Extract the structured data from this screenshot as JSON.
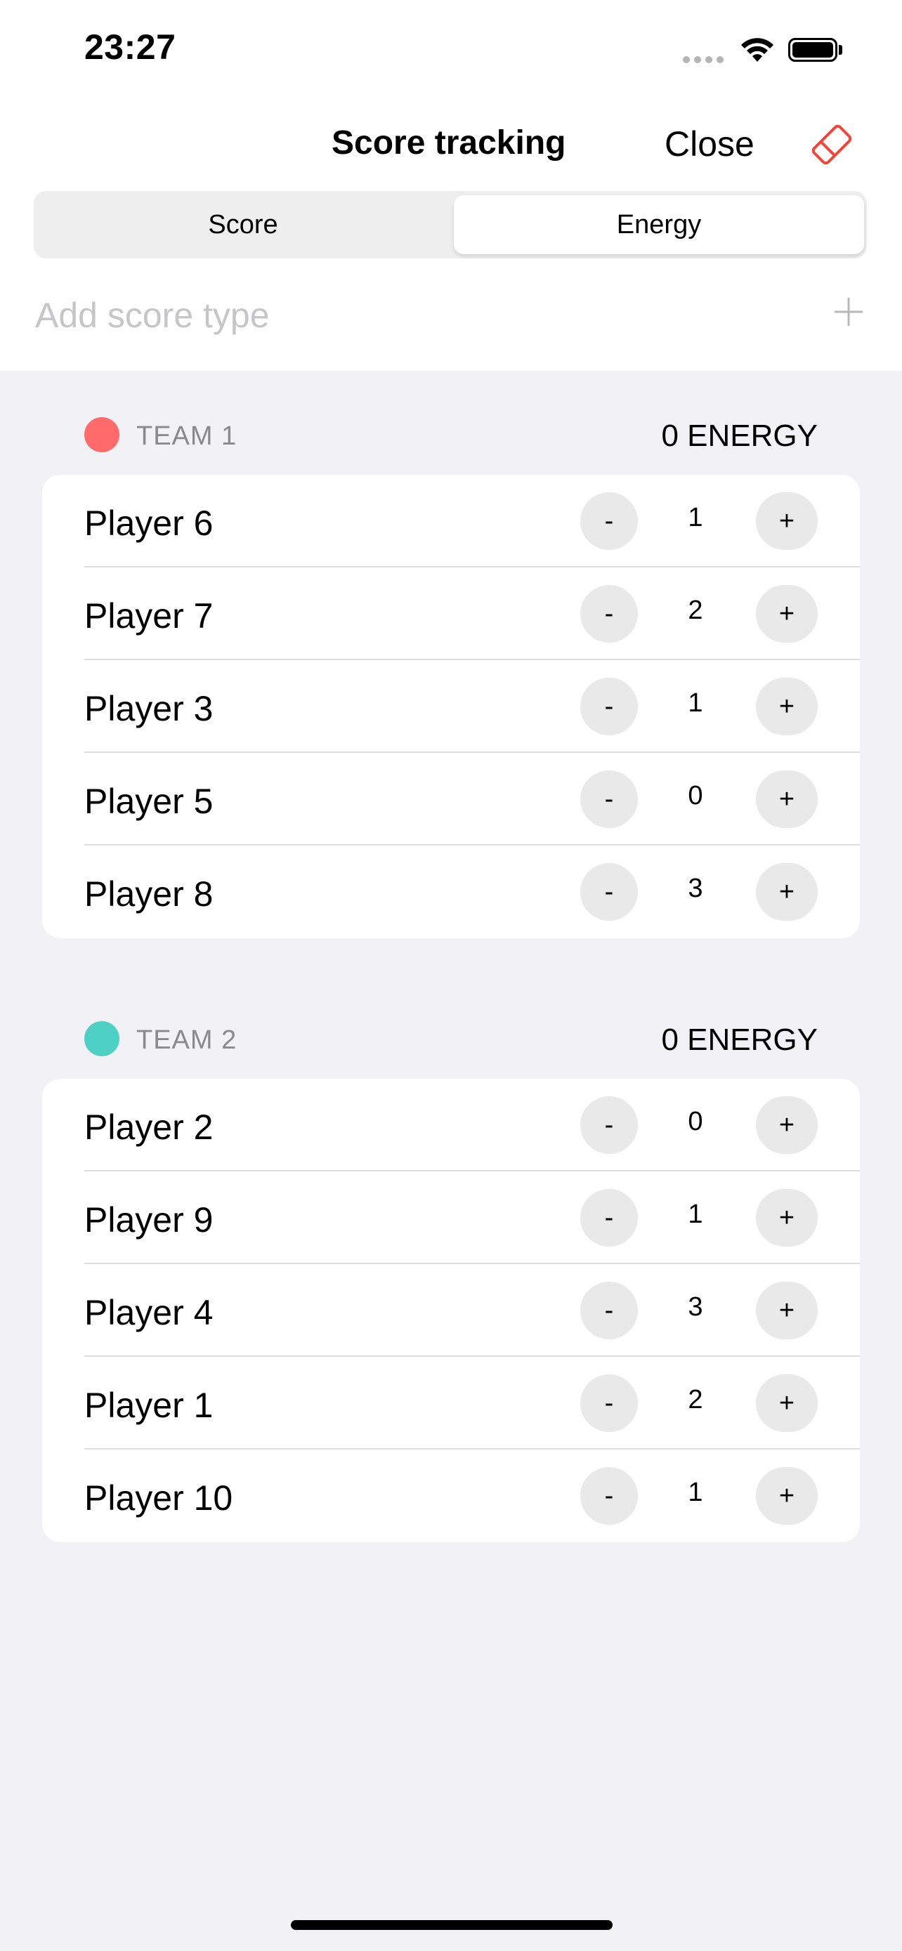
{
  "status_bar": {
    "time": "23:27",
    "icons": [
      "cellular-signal-icon",
      "wifi-icon",
      "battery-icon"
    ]
  },
  "nav": {
    "title": "Score tracking",
    "close_label": "Close",
    "eraser_icon": "eraser-icon",
    "eraser_color": "#f0453a"
  },
  "segments": {
    "items": [
      "Score",
      "Energy"
    ],
    "selected": "Energy"
  },
  "add_score": {
    "placeholder": "Add score type",
    "icon": "plus-icon"
  },
  "teams": [
    {
      "name": "TEAM 1",
      "color": "#ff6a6b",
      "total": "0 ENERGY",
      "players": [
        {
          "name": "Player 6",
          "value": "1"
        },
        {
          "name": "Player 7",
          "value": "2"
        },
        {
          "name": "Player 3",
          "value": "1"
        },
        {
          "name": "Player 5",
          "value": "0"
        },
        {
          "name": "Player 8",
          "value": "3"
        }
      ]
    },
    {
      "name": "TEAM 2",
      "color": "#4fd0c5",
      "total": "0 ENERGY",
      "players": [
        {
          "name": "Player 2",
          "value": "0"
        },
        {
          "name": "Player 9",
          "value": "1"
        },
        {
          "name": "Player 4",
          "value": "3"
        },
        {
          "name": "Player 1",
          "value": "2"
        },
        {
          "name": "Player 10",
          "value": "1"
        }
      ]
    }
  ],
  "stepper": {
    "minus_label": "-",
    "plus_label": "+"
  }
}
